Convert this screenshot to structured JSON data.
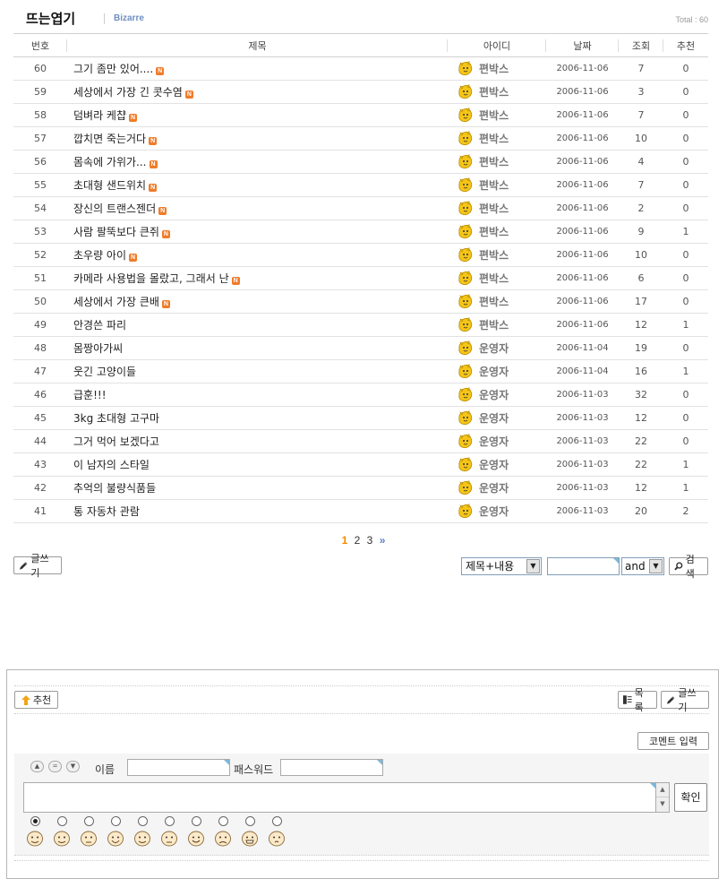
{
  "board": {
    "title": "뜨는엽기",
    "subtitle": "Bizarre",
    "total": "Total : 60"
  },
  "columns": [
    "번호",
    "제목",
    "아이디",
    "날짜",
    "조회",
    "추천"
  ],
  "posts": [
    {
      "no": "60",
      "title": "그기 좀만 있어....",
      "new": true,
      "author": "편박스",
      "date": "2006-11-06",
      "views": "7",
      "votes": "0"
    },
    {
      "no": "59",
      "title": "세상에서 가장 긴 콧수염",
      "new": true,
      "author": "편박스",
      "date": "2006-11-06",
      "views": "3",
      "votes": "0"
    },
    {
      "no": "58",
      "title": "덤벼라 케챱",
      "new": true,
      "author": "편박스",
      "date": "2006-11-06",
      "views": "7",
      "votes": "0"
    },
    {
      "no": "57",
      "title": "깝치면 죽는거다",
      "new": true,
      "author": "편박스",
      "date": "2006-11-06",
      "views": "10",
      "votes": "0"
    },
    {
      "no": "56",
      "title": "몸속에 가위가...",
      "new": true,
      "author": "편박스",
      "date": "2006-11-06",
      "views": "4",
      "votes": "0"
    },
    {
      "no": "55",
      "title": "초대형 샌드위치",
      "new": true,
      "author": "편박스",
      "date": "2006-11-06",
      "views": "7",
      "votes": "0"
    },
    {
      "no": "54",
      "title": "장신의 트랜스젠더",
      "new": true,
      "author": "편박스",
      "date": "2006-11-06",
      "views": "2",
      "votes": "0"
    },
    {
      "no": "53",
      "title": "사람 팔뚝보다 큰쥐",
      "new": true,
      "author": "편박스",
      "date": "2006-11-06",
      "views": "9",
      "votes": "1"
    },
    {
      "no": "52",
      "title": "초우량 아이",
      "new": true,
      "author": "편박스",
      "date": "2006-11-06",
      "views": "10",
      "votes": "0"
    },
    {
      "no": "51",
      "title": "카메라 사용법을 몰랐고, 그래서 난",
      "new": true,
      "author": "편박스",
      "date": "2006-11-06",
      "views": "6",
      "votes": "0"
    },
    {
      "no": "50",
      "title": "세상에서 가장 큰배",
      "new": true,
      "author": "편박스",
      "date": "2006-11-06",
      "views": "17",
      "votes": "0"
    },
    {
      "no": "49",
      "title": "안경쓴 파리",
      "new": false,
      "author": "편박스",
      "date": "2006-11-06",
      "views": "12",
      "votes": "1"
    },
    {
      "no": "48",
      "title": "몸짱아가씨",
      "new": false,
      "author": "운영자",
      "date": "2006-11-04",
      "views": "19",
      "votes": "0"
    },
    {
      "no": "47",
      "title": "웃긴 고양이들",
      "new": false,
      "author": "운영자",
      "date": "2006-11-04",
      "views": "16",
      "votes": "1"
    },
    {
      "no": "46",
      "title": "급훈!!!",
      "new": false,
      "author": "운영자",
      "date": "2006-11-03",
      "views": "32",
      "votes": "0"
    },
    {
      "no": "45",
      "title": "3kg 초대형 고구마",
      "new": false,
      "author": "운영자",
      "date": "2006-11-03",
      "views": "12",
      "votes": "0"
    },
    {
      "no": "44",
      "title": "그거 먹어 보겠다고",
      "new": false,
      "author": "운영자",
      "date": "2006-11-03",
      "views": "22",
      "votes": "0"
    },
    {
      "no": "43",
      "title": "이 남자의 스타일",
      "new": false,
      "author": "운영자",
      "date": "2006-11-03",
      "views": "22",
      "votes": "1"
    },
    {
      "no": "42",
      "title": "추억의 불량식품들",
      "new": false,
      "author": "운영자",
      "date": "2006-11-03",
      "views": "12",
      "votes": "1"
    },
    {
      "no": "41",
      "title": "통 자동차 관람",
      "new": false,
      "author": "운영자",
      "date": "2006-11-03",
      "views": "20",
      "votes": "2"
    }
  ],
  "new_badge": "N",
  "pagination": {
    "pages": [
      "1",
      "2",
      "3"
    ],
    "current": "1",
    "next": "»"
  },
  "toolbar": {
    "write_label": "글쓰기",
    "search_field": "제목+내용",
    "search_value": "",
    "search_op": "and",
    "search_label": "검색"
  },
  "comment": {
    "recommend_label": "추천",
    "list_label": "목록",
    "write_label": "글쓰기",
    "comment_input_label": "코멘트 입력",
    "name_label": "이름",
    "password_label": "패스워드",
    "name_value": "",
    "password_value": "",
    "confirm_label": "확인",
    "emoticon_selected": 0,
    "emoticon_count": 10
  },
  "colors": {
    "new_badge": "#f07c2a",
    "current_page": "#f58a00",
    "subtitle": "#6f8fbf",
    "icon_yellow": "#f5c518"
  },
  "icons": {
    "user": "user-badge-icon",
    "write": "pencil-icon",
    "search": "magnifier-icon",
    "recommend": "up-arrow-icon",
    "list": "list-icon"
  }
}
